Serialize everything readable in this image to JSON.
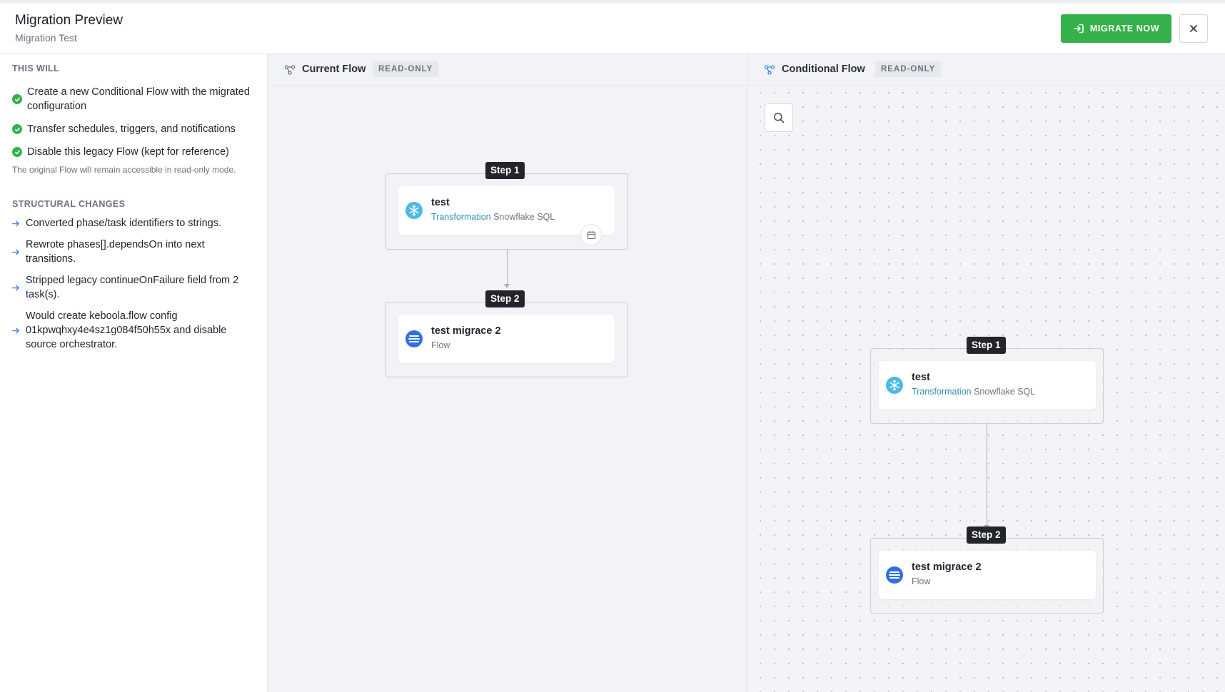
{
  "header": {
    "title": "Migration Preview",
    "subtitle": "Migration Test",
    "migrate_label": "MIGRATE NOW",
    "close_icon": "close-icon",
    "accent_color": "#34b14b"
  },
  "sidebar": {
    "this_will_heading": "THIS WILL",
    "this_will_items": [
      "Create a new Conditional Flow with the migrated configuration",
      "Transfer schedules, triggers, and notifications",
      "Disable this legacy Flow (kept for reference)"
    ],
    "note": "The original Flow will remain accessible in read-only mode.",
    "structural_heading": "STRUCTURAL CHANGES",
    "structural_items": [
      "Converted phase/task identifiers to strings.",
      "Rewrote phases[].dependsOn into next transitions.",
      "Stripped legacy continueOnFailure field from 2 task(s).",
      "Would create keboola.flow config 01kpwqhxy4e4sz1g084f50h55x and disable source orchestrator."
    ]
  },
  "current_flow": {
    "title": "Current Flow",
    "badge": "READ-ONLY",
    "steps": [
      {
        "label": "Step 1",
        "task_name": "test",
        "task_type": "Transformation",
        "task_component": "Snowflake SQL",
        "icon": "snowflake-icon",
        "has_schedule": true
      },
      {
        "label": "Step 2",
        "task_name": "test migrace 2",
        "task_type": "",
        "task_component": "Flow",
        "icon": "flow-icon",
        "has_schedule": false
      }
    ]
  },
  "conditional_flow": {
    "title": "Conditional Flow",
    "badge": "READ-ONLY",
    "steps": [
      {
        "label": "Step 1",
        "task_name": "test",
        "task_type": "Transformation",
        "task_component": "Snowflake SQL",
        "icon": "snowflake-icon"
      },
      {
        "label": "Step 2",
        "task_name": "test migrace 2",
        "task_type": "",
        "task_component": "Flow",
        "icon": "flow-icon"
      }
    ]
  }
}
